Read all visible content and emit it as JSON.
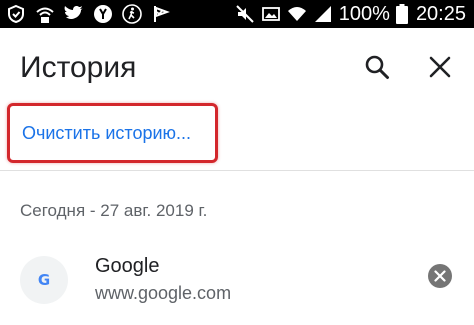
{
  "status_bar": {
    "left_icons": [
      "shield-icon",
      "wifi-lock-icon",
      "twitter-icon",
      "yandex-icon",
      "pedestrian-icon",
      "check-flag-icon"
    ],
    "right_icons": [
      "mute-icon",
      "image-icon",
      "wifi-icon",
      "signal-icon"
    ],
    "battery_percent": "100%",
    "time": "20:25"
  },
  "app_bar": {
    "title": "История",
    "search_icon": "search-icon",
    "close_icon": "close-icon"
  },
  "clear_history": {
    "label": "Очистить историю...",
    "highlight_color": "#d3272c",
    "link_color": "#1a73e8"
  },
  "history": {
    "date_header": "Сегодня - 27 авг. 2019 г.",
    "items": [
      {
        "favicon_letter": "G",
        "title": "Google",
        "url": "www.google.com",
        "remove_icon": "remove-circle-icon"
      }
    ]
  }
}
